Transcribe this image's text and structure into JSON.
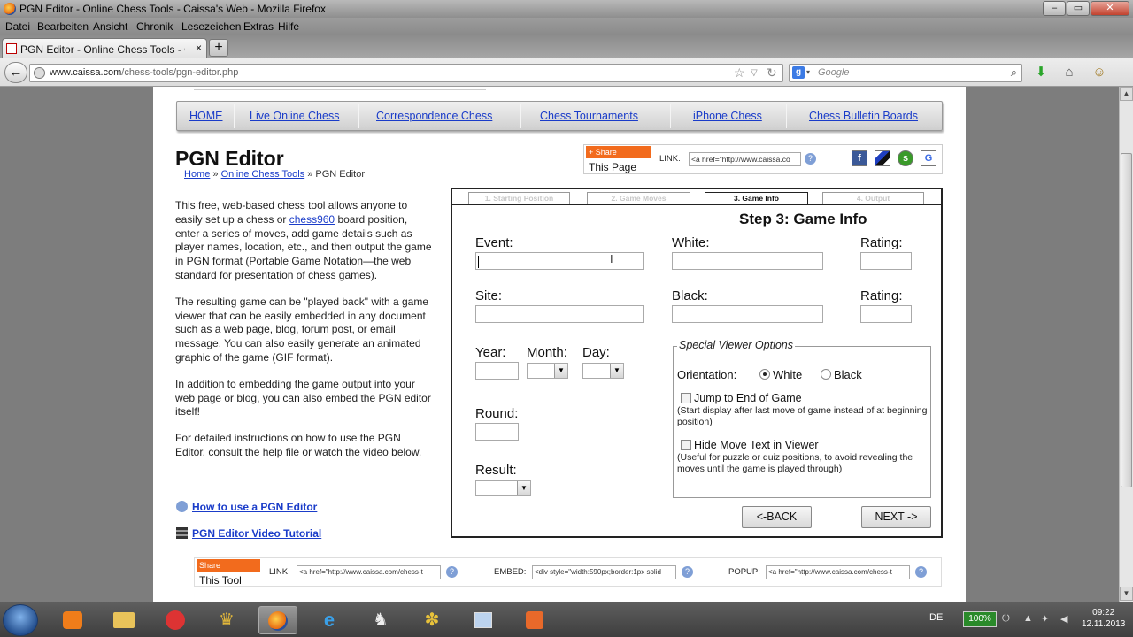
{
  "window": {
    "title": "PGN Editor - Online Chess Tools - Caissa's Web - Mozilla Firefox",
    "controls": [
      "–",
      "▭",
      "✕"
    ]
  },
  "menu": [
    "Datei",
    "Bearbeiten",
    "Ansicht",
    "Chronik",
    "Lesezeichen",
    "Extras",
    "Hilfe"
  ],
  "tab": {
    "title": "PGN Editor - Online Chess Tools - Caissa...",
    "close": "×",
    "new": "+"
  },
  "addressbar": {
    "domain": "www.caissa.com",
    "path": "/chess-tools/pgn-editor.php"
  },
  "searchbar": {
    "engine": "g",
    "placeholder": "Google"
  },
  "sitenav": [
    "HOME",
    "Live Online Chess",
    "Correspondence Chess",
    "Chess Tournaments",
    "iPhone Chess",
    "Chess Bulletin Boards"
  ],
  "page": {
    "title": "PGN Editor",
    "breadcrumb": {
      "home": "Home",
      "sep1": " » ",
      "tools": "Online Chess Tools",
      "sep2": " » ",
      "current": "PGN Editor"
    },
    "share_top": {
      "share": "+ Share",
      "this": "This Page",
      "link_label": "LINK:",
      "link_value": "<a href=\"http://www.caissa.co",
      "help": "?"
    },
    "intro": {
      "p1_a": "This free, web-based chess tool allows anyone to easily set up a chess or ",
      "p1_link": "chess960",
      "p1_b": " board position, enter a series of moves, add game details such as player names, location, etc., and then output the game in PGN format (Portable Game Notation—the web standard for presentation of chess games).",
      "p2": "The resulting game can be \"played back\" with a game viewer that can be easily embedded in any document such as a web page, blog, forum post, or email message. You can also easily generate an animated graphic of the game (GIF format).",
      "p3": "In addition to embedding the game output into your web page or blog, you can also embed the PGN editor itself!",
      "p4": "For detailed instructions on how to use the PGN Editor, consult the help file or watch the video below."
    },
    "help_links": {
      "howto": "How to use a PGN Editor",
      "video": "PGN Editor Video Tutorial"
    },
    "share_bottom": {
      "share": "Share",
      "this": "This Tool",
      "link_label": "LINK:",
      "link_value": "<a href=\"http://www.caissa.com/chess-t",
      "embed_label": "EMBED:",
      "embed_value": "<div style=\"width:590px;border:1px solid",
      "popup_label": "POPUP:",
      "popup_value": "<a href=\"http://www.caissa.com/chess-t"
    }
  },
  "editor": {
    "tabs": [
      "1. Starting Position",
      "2. Game Moves",
      "3. Game Info",
      "4. Output"
    ],
    "active_tab": 2,
    "step_title": "Step 3: Game Info",
    "labels": {
      "event": "Event:",
      "white": "White:",
      "rating1": "Rating:",
      "site": "Site:",
      "black": "Black:",
      "rating2": "Rating:",
      "year": "Year:",
      "month": "Month:",
      "day": "Day:",
      "round": "Round:",
      "result": "Result:"
    },
    "values": {
      "event": "",
      "white": "",
      "rating1": "",
      "site": "",
      "black": "",
      "rating2": "",
      "year": "",
      "month": "",
      "day": "",
      "round": "",
      "result": ""
    },
    "viewer_options": {
      "legend": "Special Viewer Options",
      "orientation_label": "Orientation:",
      "white": "White",
      "black": "Black",
      "selected": "White",
      "jump_label": "Jump to End of Game",
      "jump_desc": "(Start display after last move of game instead of at beginning position)",
      "jump_checked": false,
      "hide_label": "Hide Move Text in Viewer",
      "hide_desc": "(Useful for puzzle or quiz positions, to avoid revealing the moves until the game is played through)",
      "hide_checked": false
    },
    "buttons": {
      "back": "<-BACK",
      "next": "NEXT ->"
    }
  },
  "taskbar": {
    "language": "DE",
    "battery": "100%",
    "time": "09:22",
    "date": "12.11.2013"
  }
}
